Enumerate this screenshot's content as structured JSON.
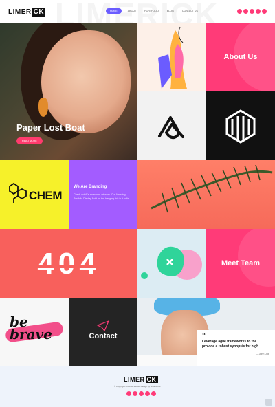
{
  "header": {
    "logo_text": "LIMER",
    "logo_box_text": "CK",
    "nav": [
      "HOME",
      "ABOUT",
      "PORTFOLIO",
      "BLOG",
      "CONTACT US"
    ],
    "active_index": 0,
    "social_icons": [
      "facebook-icon",
      "twitter-icon",
      "instagram-icon",
      "dribbble-icon",
      "behance-icon"
    ],
    "background_word": "LIMERICK"
  },
  "hero": {
    "title": "Paper Lost Boat",
    "button": "READ MORE"
  },
  "tiles": {
    "about_us": "About Us",
    "chem": "CHEM",
    "branding_title": "We Are Branding",
    "branding_text": "Check out Al’s awesome art work. Our Amazing Portfolio Display Bold on the hanging this is it to fix.",
    "error_text": "404",
    "team": "Meet Team",
    "brave_text": "be brave",
    "contact": "Contact"
  },
  "quote": {
    "text": "Leverage agile frameworks to the provide a robust synopsis for high",
    "author": "— John Doe"
  },
  "footer": {
    "logo_text": "LIMER",
    "logo_box_text": "CK",
    "copyright": "© Copyright Limerick theme. Design by Greenwind.",
    "social_icons": [
      "facebook-icon",
      "twitter-icon",
      "instagram-icon",
      "dribbble-icon",
      "behance-icon"
    ]
  },
  "colors": {
    "accent_pink": "#ff3b78",
    "accent_purple": "#a35cff",
    "accent_yellow": "#f6f12a",
    "accent_coral": "#f8605c"
  }
}
